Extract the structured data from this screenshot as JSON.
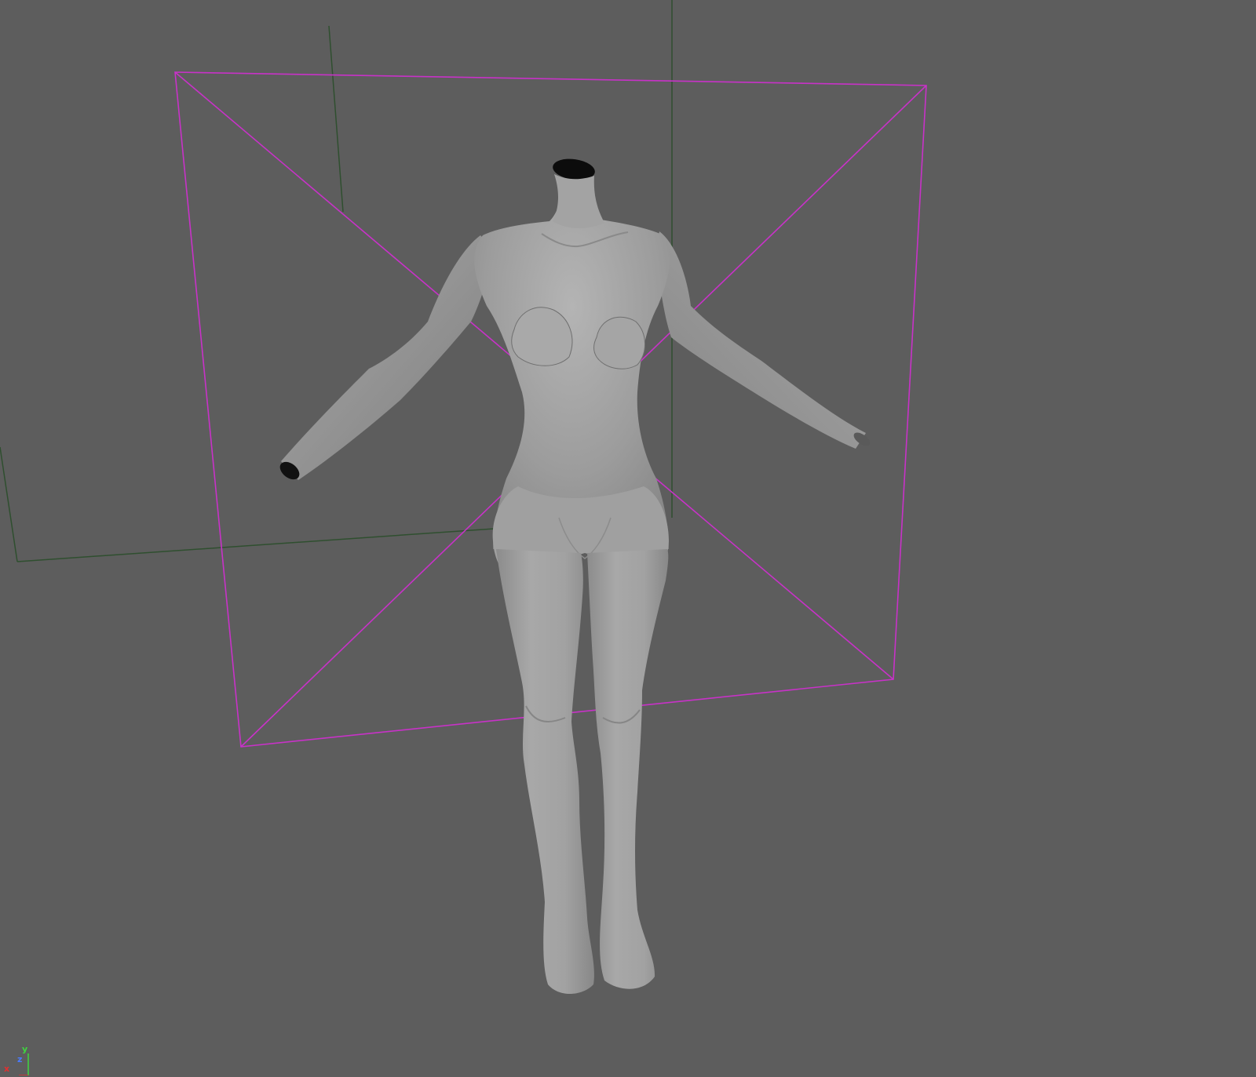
{
  "viewport": {
    "background_color": "#5d5d5d",
    "bounding_box_color": "#c832c8",
    "grid_line_color": "#2f4f2f",
    "mesh_color": "#a6a6a6"
  },
  "axis_gizmo": {
    "x_label": "x",
    "y_label": "y",
    "z_label": "z",
    "x_color": "#e23030",
    "y_color": "#3fd63f",
    "z_color": "#4a7bff"
  }
}
